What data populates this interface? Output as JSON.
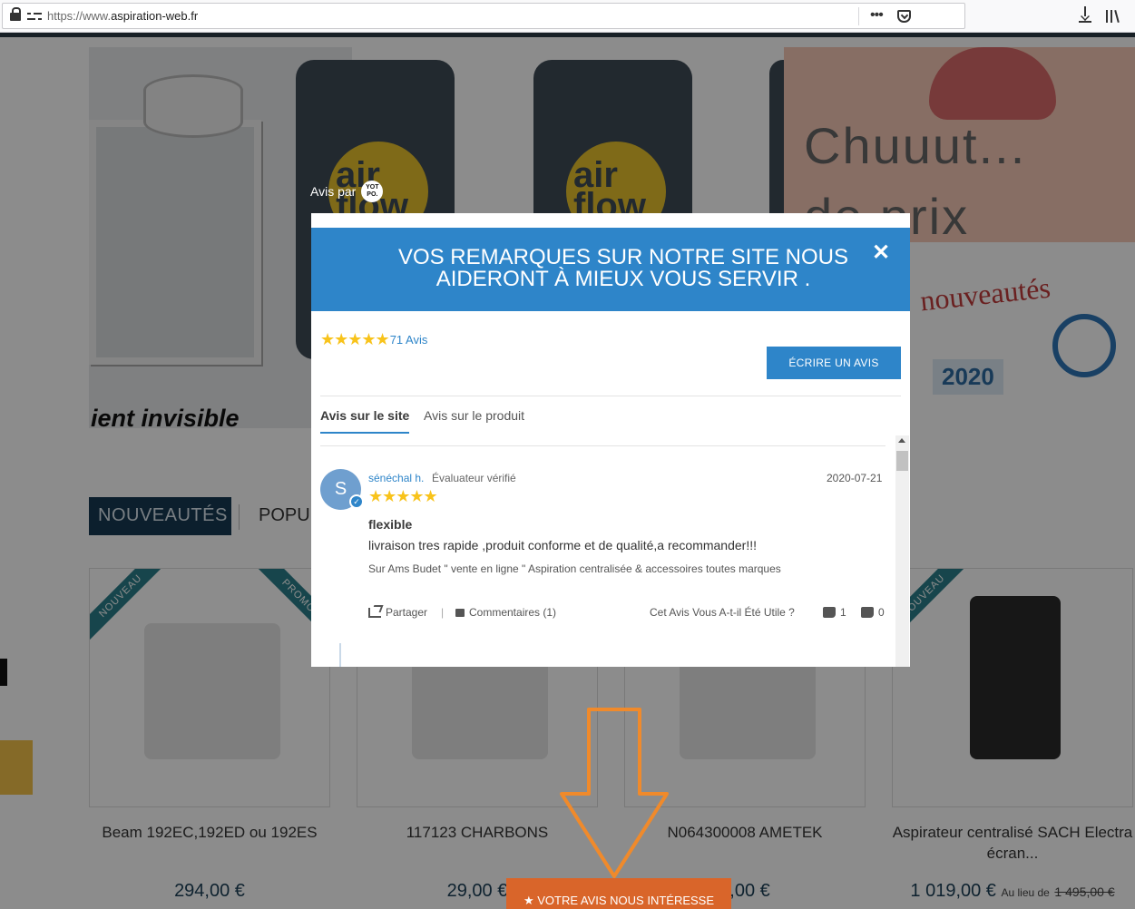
{
  "browser": {
    "url_prefix": "https://www.",
    "url_domain": "aspiration-web.fr",
    "icons": [
      "lock-icon",
      "permissions-icon",
      "more-icon",
      "pocket-icon",
      "download-icon",
      "library-icon"
    ]
  },
  "background": {
    "hero_tagline": "ient invisible",
    "can_logo_text": "air flow",
    "promo_text": "Chuuut...\nde prix",
    "nouveautes_word": "nouveautés",
    "nouveautes_year": "2020",
    "tabs": {
      "active": "NOUVEAUTÉS",
      "other": "POPU"
    },
    "products": [
      {
        "ribbon": "NOUVEAU",
        "ribbon2": "PROMO",
        "name": "Beam 192EC,192ED ou 192ES",
        "price": "294,00 €"
      },
      {
        "name": "117123 CHARBONS",
        "price": "29,00 €"
      },
      {
        "name": "N064300008 AMETEK",
        "price": "7,00 €"
      },
      {
        "ribbon": "NOUVEAU",
        "name": "Aspirateur centralisé SACH Electra écran...",
        "price": "1 019,00 €",
        "price_note": "Au lieu de",
        "old_price": "1 495,00 €"
      }
    ],
    "feedback_button": "★ VOTRE AVIS NOUS INTÉRESSE",
    "colors": {
      "overlay": "#000000",
      "arrow": "#f08a2b",
      "feedback": "#d9652a"
    }
  },
  "modal": {
    "powered_by": "Avis par",
    "powered_logo": "YOT\nPO.",
    "header_line1": "VOS REMARQUES SUR NOTRE SITE NOUS",
    "header_line2": "AIDERONT À MIEUX VOUS SERVIR .",
    "close": "✕",
    "rating_stars": 5,
    "review_count": "71 Avis",
    "write_button": "ÉCRIRE UN AVIS",
    "tab_site": "Avis sur le site",
    "tab_product": "Avis sur le produit",
    "accent": "#2e85c9",
    "star_color": "#f8c31b",
    "review": {
      "avatar_letter": "S",
      "author": "sénéchal h.",
      "verified": "Évaluateur vérifié",
      "date": "2020-07-21",
      "stars": 5,
      "title": "flexible",
      "body": "livraison tres rapide ,produit conforme et de qualité,a recommander!!!",
      "product": "Sur Ams Budet \" vente en ligne \" Aspiration centralisée & accessoires toutes marques",
      "share": "Partager",
      "separator": "|",
      "comments": "Commentaires (1)",
      "helpful": "Cet Avis Vous A-t-il Été Utile ?",
      "up_count": "1",
      "down_count": "0"
    }
  }
}
